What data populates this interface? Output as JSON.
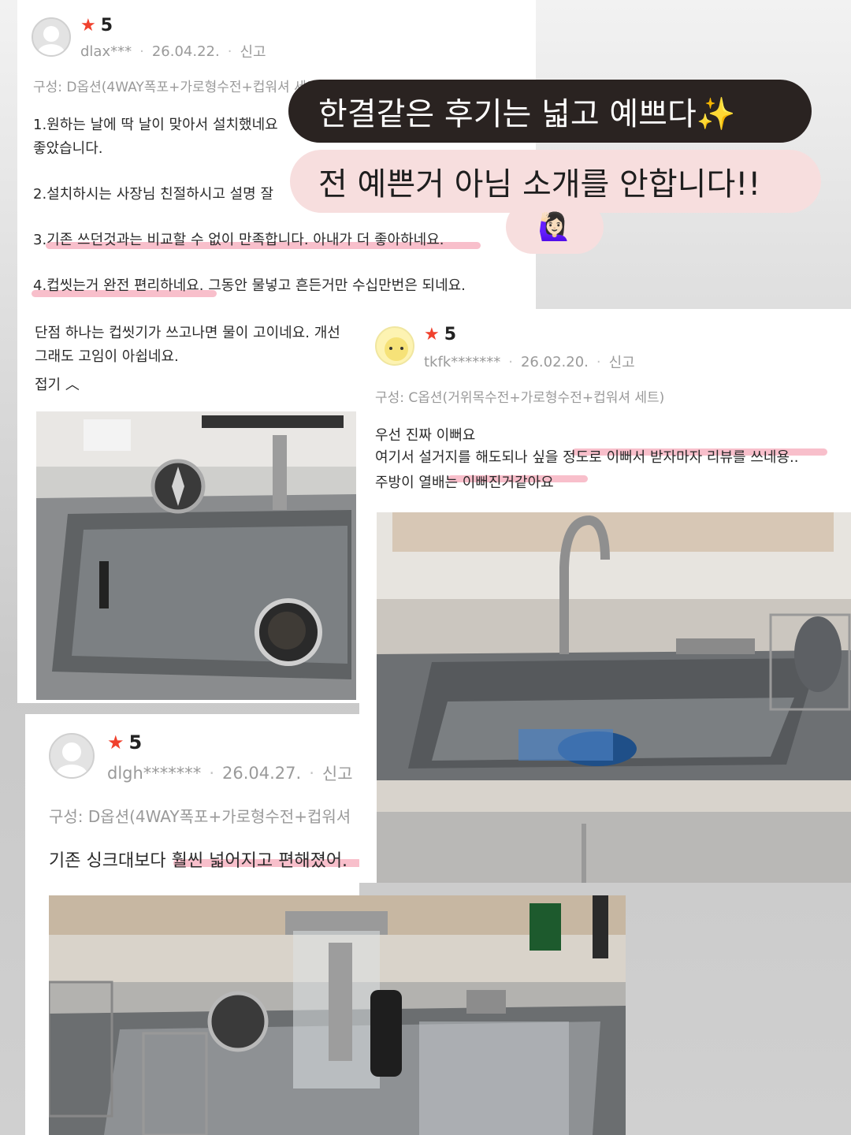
{
  "review1": {
    "rating": "5",
    "username": "dlax***",
    "date": "26.04.22.",
    "report": "신고",
    "option": "구성: D옵션(4WAY폭포+가로형수전+컵워셔 세트)",
    "lines": [
      "1.원하는 날에 딱 날이 맞아서 설치했네요",
      "좋았습니다.",
      "2.설치하시는 사장님 친절하시고 설명 잘",
      "3.기존 쓰던것과는 비교할 수 없이 만족합니다. 아내가 더 좋아하네요.",
      "4.컵씻는거 완전 편리하네요. 그동안 물넣고 흔든거만 수십만번은 되네요.",
      "단점 하나는 컵씻기가 쓰고나면 물이 고이네요. 개선",
      "그래도 고임이 아쉽네요."
    ],
    "collapse": "접기"
  },
  "review2": {
    "rating": "5",
    "username": "tkfk*******",
    "date": "26.02.20.",
    "report": "신고",
    "option": "구성: C옵션(거위목수전+가로형수전+컵워셔 세트)",
    "lines": [
      "우선 진짜 이뻐요",
      "여기서 설거지를 해도되나 싶을 정도로 이뻐서 받자마자 리뷰를 쓰네용..",
      "주방이 열배는 이뻐진거같아요"
    ]
  },
  "review3": {
    "rating": "5",
    "username": "dlgh*******",
    "date": "26.04.27.",
    "report": "신고",
    "option": "구성: D옵션(4WAY폭포+가로형수전+컵워셔",
    "line": "기존 싱크대보다 훨씬 넓어지고 편해졌어."
  },
  "overlay": {
    "text1": "한결같은 후기는 넓고 예쁘다✨",
    "text2": "전 예쁜거 아님 소개를 안합니다!!",
    "emoji": "🙋🏻‍♀️"
  },
  "colors": {
    "star": "#f0412d",
    "highlight": "#f5aab9",
    "bubble_dark": "#2a2321",
    "bubble_light": "#f7dede"
  },
  "icons": [
    "avatar-placeholder-icon",
    "star-icon",
    "chevron-up-icon",
    "raise-hand-emoji"
  ]
}
